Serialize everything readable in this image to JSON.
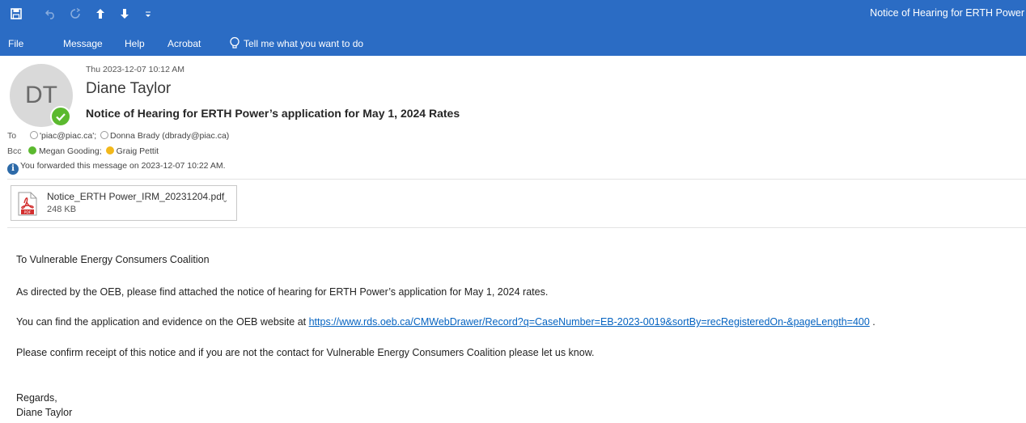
{
  "window": {
    "title": "Notice of Hearing for ERTH Power"
  },
  "quick_access": {
    "save_icon": "save-icon",
    "undo_icon": "undo-icon",
    "redo_icon": "redo-icon",
    "up_icon": "arrow-up-icon",
    "down_icon": "arrow-down-icon",
    "customize_icon": "customize-icon"
  },
  "menu": {
    "items": [
      "File",
      "Message",
      "Help",
      "Acrobat"
    ],
    "tell_me": "Tell me what you want to do"
  },
  "message": {
    "avatar_initials": "DT",
    "timestamp": "Thu 2023-12-07 10:12 AM",
    "sender": "Diane Taylor",
    "subject": "Notice of Hearing for ERTH Power’s application for May 1, 2024 Rates",
    "to_label": "To",
    "to_recipients": [
      "'piac@piac.ca';",
      "Donna Brady (dbrady@piac.ca)"
    ],
    "bcc_label": "Bcc",
    "bcc_recipients": [
      "Megan Gooding;",
      "Graig Pettit"
    ],
    "forward_info": "You forwarded this message on 2023-12-07 10:22 AM."
  },
  "attachment": {
    "name": "Notice_ERTH Power_IRM_20231204.pdf",
    "size": "248 KB",
    "icon": "pdf-icon"
  },
  "body": {
    "greeting": "To Vulnerable Energy Consumers Coalition",
    "para1": "As directed by the OEB, please find attached the notice of hearing for ERTH Power’s application for May 1, 2024 rates.",
    "para2_prefix": "You can find the application and evidence on the OEB website at ",
    "para2_link": "https://www.rds.oeb.ca/CMWebDrawer/Record?q=CaseNumber=EB-2023-0019&sortBy=recRegisteredOn-&pageLength=400",
    "para2_suffix": " .",
    "para3": "Please confirm receipt of this notice and if you are not the contact for Vulnerable Energy Consumers Coalition please let us know.",
    "sign_off": "Regards,",
    "signature": "Diane Taylor"
  },
  "colors": {
    "titlebar": "#2b6cc4",
    "presence_green": "#5bb92f",
    "presence_yellow": "#f2b81b",
    "link": "#0563c1"
  }
}
